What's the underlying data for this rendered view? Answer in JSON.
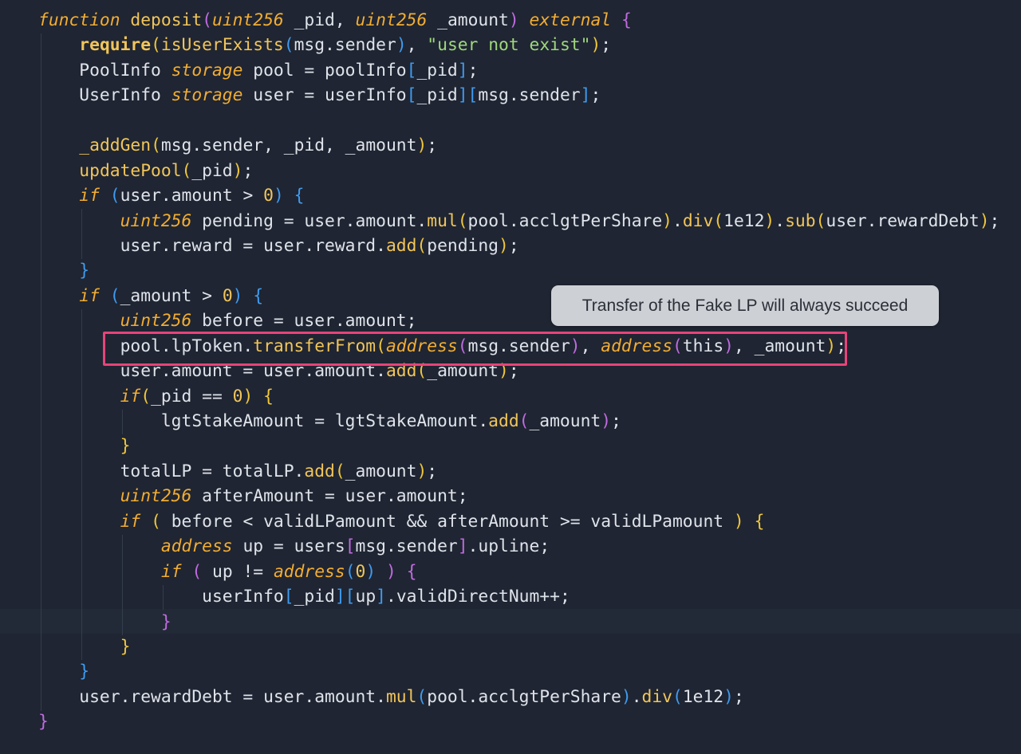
{
  "tooltip": {
    "text": "Transfer of the Fake LP will always succeed"
  },
  "colors": {
    "background": "#1f2532",
    "keyword": "#f2ad32",
    "function": "#f1c55a",
    "string": "#9fd77d",
    "bracket_blue": "#3f9bef",
    "bracket_purple": "#c06be0",
    "highlight_box": "#e74479",
    "tooltip_bg": "#cdd0d5"
  },
  "code": {
    "lines": [
      [
        [
          "kw",
          "function"
        ],
        [
          "pl",
          " "
        ],
        [
          "fn",
          "deposit"
        ],
        [
          "pP",
          "("
        ],
        [
          "kw",
          "uint256"
        ],
        [
          "pl",
          " _pid, "
        ],
        [
          "kw",
          "uint256"
        ],
        [
          "pl",
          " _amount"
        ],
        [
          "pP",
          ")"
        ],
        [
          "pl",
          " "
        ],
        [
          "kw",
          "external"
        ],
        [
          "pl",
          " "
        ],
        [
          "pP",
          "{"
        ]
      ],
      [
        [
          "pl",
          "    "
        ],
        [
          "fnb",
          "require"
        ],
        [
          "pY",
          "("
        ],
        [
          "fn",
          "isUserExists"
        ],
        [
          "pB",
          "("
        ],
        [
          "pl",
          "msg.sender"
        ],
        [
          "pB",
          ")"
        ],
        [
          "pl",
          ", "
        ],
        [
          "str",
          "\"user not exist\""
        ],
        [
          "pY",
          ")"
        ],
        [
          "pl",
          ";"
        ]
      ],
      [
        [
          "pl",
          "    PoolInfo "
        ],
        [
          "kw",
          "storage"
        ],
        [
          "pl",
          " pool = poolInfo"
        ],
        [
          "pB",
          "["
        ],
        [
          "pl",
          "_pid"
        ],
        [
          "pB",
          "]"
        ],
        [
          "pl",
          ";"
        ]
      ],
      [
        [
          "pl",
          "    UserInfo "
        ],
        [
          "kw",
          "storage"
        ],
        [
          "pl",
          " user = userInfo"
        ],
        [
          "pB",
          "["
        ],
        [
          "pl",
          "_pid"
        ],
        [
          "pB",
          "]["
        ],
        [
          "pl",
          "msg.sender"
        ],
        [
          "pB",
          "]"
        ],
        [
          "pl",
          ";"
        ]
      ],
      [
        [
          "pl",
          ""
        ]
      ],
      [
        [
          "pl",
          "    "
        ],
        [
          "fn",
          "_addGen"
        ],
        [
          "pY",
          "("
        ],
        [
          "pl",
          "msg.sender, _pid, _amount"
        ],
        [
          "pY",
          ")"
        ],
        [
          "pl",
          ";"
        ]
      ],
      [
        [
          "pl",
          "    "
        ],
        [
          "fn",
          "updatePool"
        ],
        [
          "pY",
          "("
        ],
        [
          "pl",
          "_pid"
        ],
        [
          "pY",
          ")"
        ],
        [
          "pl",
          ";"
        ]
      ],
      [
        [
          "pl",
          "    "
        ],
        [
          "kw",
          "if"
        ],
        [
          "pl",
          " "
        ],
        [
          "pB",
          "("
        ],
        [
          "pl",
          "user.amount > "
        ],
        [
          "num",
          "0"
        ],
        [
          "pB",
          ")"
        ],
        [
          "pl",
          " "
        ],
        [
          "pB",
          "{"
        ]
      ],
      [
        [
          "pl",
          "        "
        ],
        [
          "kw",
          "uint256"
        ],
        [
          "pl",
          " pending = user.amount."
        ],
        [
          "fn",
          "mul"
        ],
        [
          "pY",
          "("
        ],
        [
          "pl",
          "pool.acclgtPerShare"
        ],
        [
          "pY",
          ")"
        ],
        [
          "pl",
          "."
        ],
        [
          "fn",
          "div"
        ],
        [
          "pY",
          "("
        ],
        [
          "pl",
          "1e12"
        ],
        [
          "pY",
          ")"
        ],
        [
          "pl",
          "."
        ],
        [
          "fn",
          "sub"
        ],
        [
          "pY",
          "("
        ],
        [
          "pl",
          "user.rewardDebt"
        ],
        [
          "pY",
          ")"
        ],
        [
          "pl",
          ";"
        ]
      ],
      [
        [
          "pl",
          "        user.reward = user.reward."
        ],
        [
          "fn",
          "add"
        ],
        [
          "pY",
          "("
        ],
        [
          "pl",
          "pending"
        ],
        [
          "pY",
          ")"
        ],
        [
          "pl",
          ";"
        ]
      ],
      [
        [
          "pl",
          "    "
        ],
        [
          "pB",
          "}"
        ]
      ],
      [
        [
          "pl",
          "    "
        ],
        [
          "kw",
          "if"
        ],
        [
          "pl",
          " "
        ],
        [
          "pB",
          "("
        ],
        [
          "pl",
          "_amount > "
        ],
        [
          "num",
          "0"
        ],
        [
          "pB",
          ")"
        ],
        [
          "pl",
          " "
        ],
        [
          "pB",
          "{"
        ]
      ],
      [
        [
          "pl",
          "        "
        ],
        [
          "kw",
          "uint256"
        ],
        [
          "pl",
          " before = user.amount;"
        ]
      ],
      [
        [
          "pl",
          "        pool.lpToken."
        ],
        [
          "fn",
          "transferFrom"
        ],
        [
          "pY",
          "("
        ],
        [
          "kw",
          "address"
        ],
        [
          "pP",
          "("
        ],
        [
          "pl",
          "msg.sender"
        ],
        [
          "pP",
          ")"
        ],
        [
          "pl",
          ", "
        ],
        [
          "kw",
          "address"
        ],
        [
          "pP",
          "("
        ],
        [
          "pl",
          "this"
        ],
        [
          "pP",
          ")"
        ],
        [
          "pl",
          ", _amount"
        ],
        [
          "pY",
          ")"
        ],
        [
          "pl",
          ";"
        ]
      ],
      [
        [
          "pl",
          "        user.amount = user.amount."
        ],
        [
          "fn",
          "add"
        ],
        [
          "pY",
          "("
        ],
        [
          "pl",
          "_amount"
        ],
        [
          "pY",
          ")"
        ],
        [
          "pl",
          ";"
        ]
      ],
      [
        [
          "pl",
          "        "
        ],
        [
          "kw",
          "if"
        ],
        [
          "pY",
          "("
        ],
        [
          "pl",
          "_pid == "
        ],
        [
          "num",
          "0"
        ],
        [
          "pY",
          ")"
        ],
        [
          "pl",
          " "
        ],
        [
          "pY",
          "{"
        ]
      ],
      [
        [
          "pl",
          "            lgtStakeAmount = lgtStakeAmount."
        ],
        [
          "fn",
          "add"
        ],
        [
          "pP",
          "("
        ],
        [
          "pl",
          "_amount"
        ],
        [
          "pP",
          ")"
        ],
        [
          "pl",
          ";"
        ]
      ],
      [
        [
          "pl",
          "        "
        ],
        [
          "pY",
          "}"
        ]
      ],
      [
        [
          "pl",
          "        totalLP = totalLP."
        ],
        [
          "fn",
          "add"
        ],
        [
          "pY",
          "("
        ],
        [
          "pl",
          "_amount"
        ],
        [
          "pY",
          ")"
        ],
        [
          "pl",
          ";"
        ]
      ],
      [
        [
          "pl",
          "        "
        ],
        [
          "kw",
          "uint256"
        ],
        [
          "pl",
          " afterAmount = user.amount;"
        ]
      ],
      [
        [
          "pl",
          "        "
        ],
        [
          "kw",
          "if"
        ],
        [
          "pl",
          " "
        ],
        [
          "pY",
          "("
        ],
        [
          "pl",
          " before < validLPamount && afterAmount >= validLPamount "
        ],
        [
          "pY",
          ")"
        ],
        [
          "pl",
          " "
        ],
        [
          "pY",
          "{"
        ]
      ],
      [
        [
          "pl",
          "            "
        ],
        [
          "kw",
          "address"
        ],
        [
          "pl",
          " up = users"
        ],
        [
          "pP",
          "["
        ],
        [
          "pl",
          "msg.sender"
        ],
        [
          "pP",
          "]"
        ],
        [
          "pl",
          ".upline;"
        ]
      ],
      [
        [
          "pl",
          "            "
        ],
        [
          "kw",
          "if"
        ],
        [
          "pl",
          " "
        ],
        [
          "pP",
          "("
        ],
        [
          "pl",
          " up != "
        ],
        [
          "kw",
          "address"
        ],
        [
          "pB",
          "("
        ],
        [
          "num",
          "0"
        ],
        [
          "pB",
          ")"
        ],
        [
          "pl",
          " "
        ],
        [
          "pP",
          ")"
        ],
        [
          "pl",
          " "
        ],
        [
          "pP",
          "{"
        ]
      ],
      [
        [
          "pl",
          "                userInfo"
        ],
        [
          "pB",
          "["
        ],
        [
          "pl",
          "_pid"
        ],
        [
          "pB",
          "]["
        ],
        [
          "pl",
          "up"
        ],
        [
          "pB",
          "]"
        ],
        [
          "pl",
          ".validDirectNum++;"
        ]
      ],
      [
        [
          "pl",
          "            "
        ],
        [
          "pP",
          "}"
        ]
      ],
      [
        [
          "pl",
          "        "
        ],
        [
          "pY",
          "}"
        ]
      ],
      [
        [
          "pl",
          "    "
        ],
        [
          "pB",
          "}"
        ]
      ],
      [
        [
          "pl",
          "    user.rewardDebt = user.amount."
        ],
        [
          "fn",
          "mul"
        ],
        [
          "pB",
          "("
        ],
        [
          "pl",
          "pool.acclgtPerShare"
        ],
        [
          "pB",
          ")"
        ],
        [
          "pl",
          "."
        ],
        [
          "fn",
          "div"
        ],
        [
          "pB",
          "("
        ],
        [
          "pl",
          "1e12"
        ],
        [
          "pB",
          ")"
        ],
        [
          "pl",
          ";"
        ]
      ],
      [
        [
          "pP",
          "}"
        ]
      ]
    ]
  }
}
